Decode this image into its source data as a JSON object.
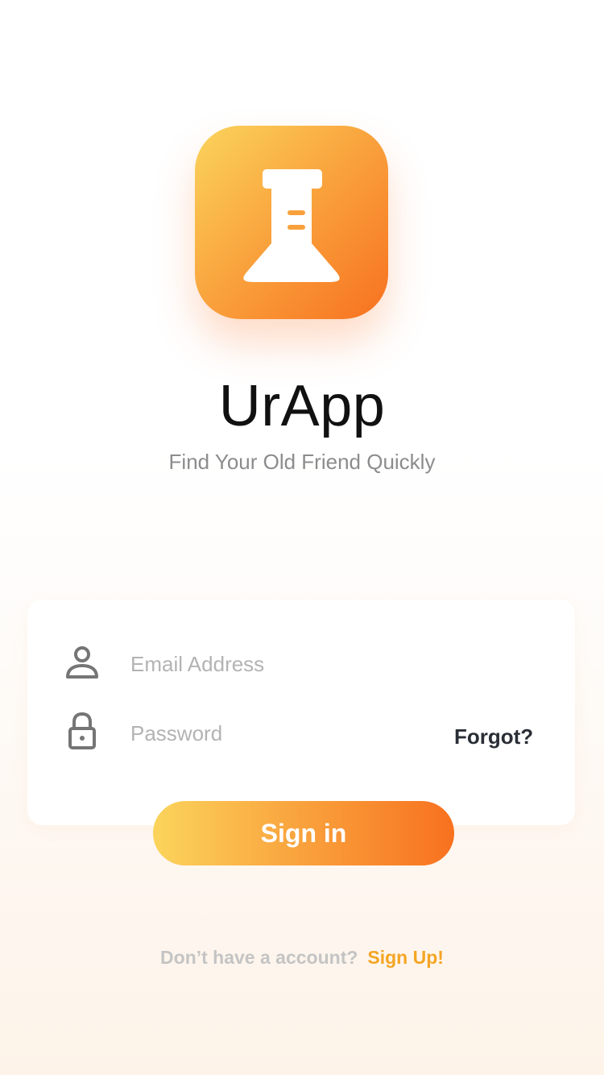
{
  "app": {
    "name": "UrApp",
    "tagline": "Find Your Old Friend Quickly",
    "icon": "flask-icon"
  },
  "login": {
    "email_placeholder": "Email Address",
    "email_icon": "user-icon",
    "password_placeholder": "Password",
    "password_icon": "lock-icon",
    "forgot_label": "Forgot?",
    "signin_label": "Sign in"
  },
  "signup": {
    "prompt": "Don’t have a account?",
    "link_label": "Sign Up!"
  },
  "colors": {
    "accent_start": "#fbd45c",
    "accent_end": "#f8711f",
    "link": "#f5a524"
  }
}
